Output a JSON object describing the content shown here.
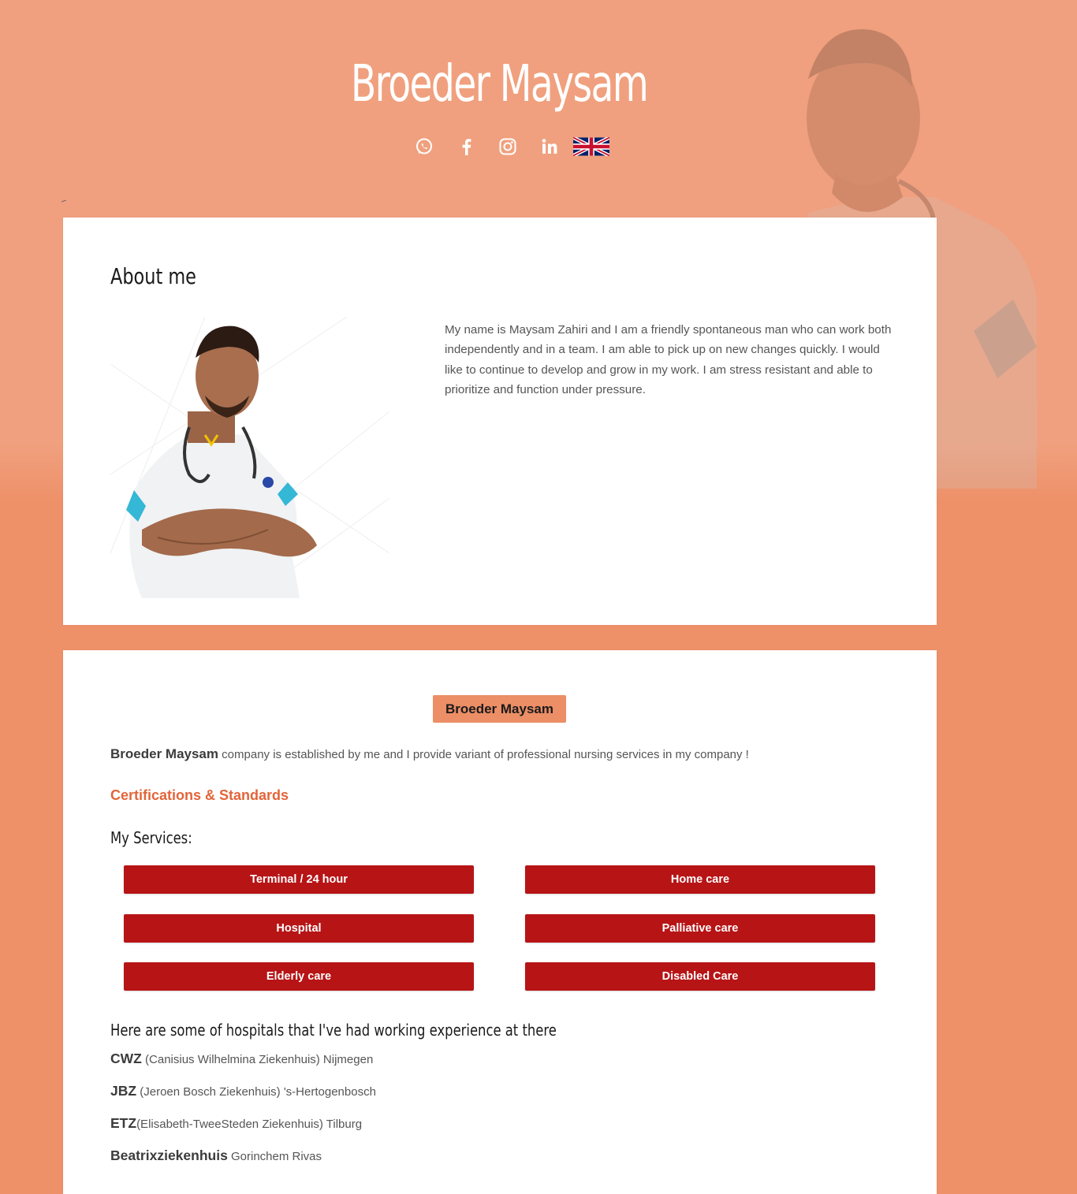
{
  "header": {
    "title": "Broeder Maysam",
    "social": [
      {
        "icon": "whatsapp-icon"
      },
      {
        "icon": "facebook-icon"
      },
      {
        "icon": "instagram-icon"
      },
      {
        "icon": "linkedin-icon"
      },
      {
        "icon": "uk-flag-icon"
      }
    ]
  },
  "about": {
    "heading": "About me",
    "text": "My name is Maysam Zahiri and I am a friendly spontaneous man who can work both independently and in a team. I am able to pick up on new changes quickly. I would like to continue to develop and grow in my work. I am stress resistant and able to prioritize and function under pressure."
  },
  "services_section": {
    "badge": "Broeder Maysam",
    "intro_strong": "Broeder Maysam",
    "intro_rest": " company is established by me and I provide variant of professional nursing services in my company !",
    "cert_link": "Certifications & Standards",
    "services_heading": "My Services:",
    "services": [
      "Terminal / 24 hour",
      "Home care",
      "Hospital",
      "Palliative care",
      "Elderly care",
      "Disabled Care"
    ],
    "hospitals_heading": "Here are some of hospitals that I've had working experience at there",
    "hospitals": [
      {
        "abbr": "CWZ",
        "detail": " (Canisius Wilhelmina Ziekenhuis) Nijmegen"
      },
      {
        "abbr": "JBZ",
        "detail": " (Jeroen Bosch Ziekenhuis) 's-Hertogenbosch"
      },
      {
        "abbr": "ETZ",
        "detail": "(Elisabeth-TweeSteden Ziekenhuis) Tilburg"
      },
      {
        "abbr": "Beatrixziekenhuis",
        "detail": " Gorinchem Rivas"
      }
    ]
  },
  "colors": {
    "page_background": "#ee9068",
    "hero_background": "#f0a07e",
    "badge": "#ec8e66",
    "service_button": "#b71416",
    "accent_link": "#e2653a"
  }
}
